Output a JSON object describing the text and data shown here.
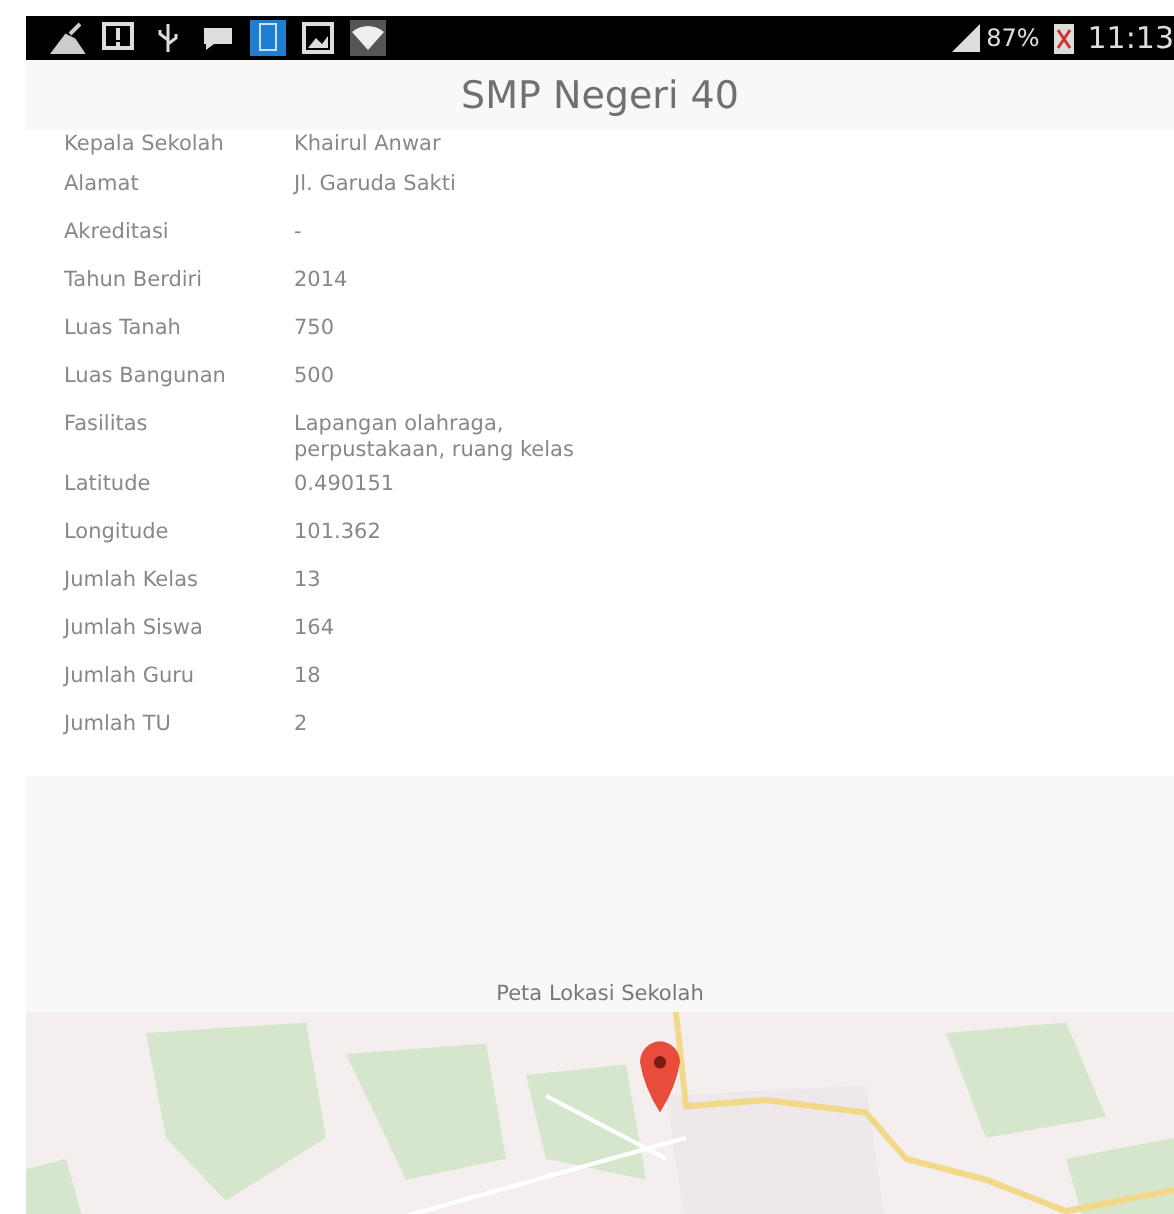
{
  "status_bar": {
    "battery": "87%",
    "time": "11:13"
  },
  "title": "SMP Negeri 40",
  "details": [
    {
      "label": "Kepala Sekolah",
      "value": "Khairul Anwar",
      "kind": "clipped"
    },
    {
      "label": "Alamat",
      "value": "Jl. Garuda Sakti",
      "kind": "row"
    },
    {
      "label": "Akreditasi",
      "value": "-",
      "kind": "row"
    },
    {
      "label": "Tahun Berdiri",
      "value": "2014",
      "kind": "row"
    },
    {
      "label": "Luas Tanah",
      "value": "750",
      "kind": "row"
    },
    {
      "label": "Luas Bangunan",
      "value": "500",
      "kind": "row"
    },
    {
      "label": "Fasilitas",
      "value": "Lapangan olahraga,\nperpustakaan, ruang kelas",
      "kind": "row"
    },
    {
      "label": "Latitude",
      "value": "0.490151",
      "kind": "row"
    },
    {
      "label": "Longitude",
      "value": "101.362",
      "kind": "row"
    },
    {
      "label": "Jumlah Kelas",
      "value": "13",
      "kind": "row"
    },
    {
      "label": "Jumlah Siswa",
      "value": "164",
      "kind": "row"
    },
    {
      "label": "Jumlah Guru",
      "value": "18",
      "kind": "row"
    },
    {
      "label": "Jumlah TU",
      "value": "2",
      "kind": "row"
    }
  ],
  "map": {
    "caption": "Peta Lokasi Sekolah",
    "kind": "picture"
  }
}
